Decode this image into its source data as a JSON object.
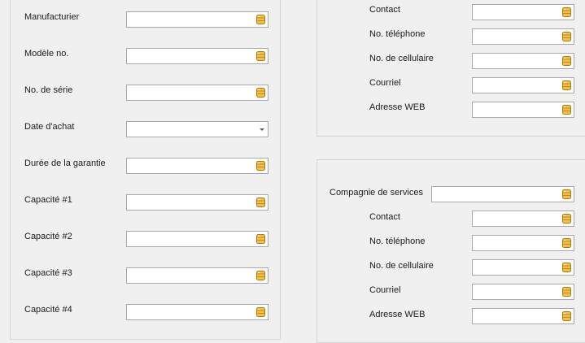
{
  "left_form": {
    "fields": [
      {
        "label": "Manufacturier",
        "value": "",
        "kind": "db"
      },
      {
        "label": "Modèle no.",
        "value": "",
        "kind": "db"
      },
      {
        "label": "No. de série",
        "value": "",
        "kind": "db"
      },
      {
        "label": "Date d'achat",
        "value": "",
        "kind": "date"
      },
      {
        "label": "Durée de la garantie",
        "value": "",
        "kind": "db"
      },
      {
        "label": "Capacité #1",
        "value": "",
        "kind": "db"
      },
      {
        "label": "Capacité #2",
        "value": "",
        "kind": "db"
      },
      {
        "label": "Capacité #3",
        "value": "",
        "kind": "db"
      },
      {
        "label": "Capacité #4",
        "value": "",
        "kind": "db"
      }
    ]
  },
  "supplier_panel": {
    "contacts": [
      {
        "label": "Contact",
        "value": ""
      },
      {
        "label": "No. téléphone",
        "value": ""
      },
      {
        "label": "No. de cellulaire",
        "value": ""
      },
      {
        "label": "Courriel",
        "value": ""
      },
      {
        "label": "Adresse WEB",
        "value": ""
      }
    ]
  },
  "service_panel": {
    "company_label": "Compagnie de services",
    "company_value": "",
    "contacts": [
      {
        "label": "Contact",
        "value": ""
      },
      {
        "label": "No. téléphone",
        "value": ""
      },
      {
        "label": "No. de cellulaire",
        "value": ""
      },
      {
        "label": "Courriel",
        "value": ""
      },
      {
        "label": "Adresse WEB",
        "value": ""
      }
    ]
  },
  "icons": {
    "field_icon": "database-icon",
    "date_icon": "chevron-down-icon"
  },
  "colors": {
    "background": "#f0f0f0",
    "field_border": "#a9a9a9",
    "panel_border": "#d5d5d5",
    "icon_fill": "#f5c04a",
    "icon_stroke": "#b07c12"
  }
}
